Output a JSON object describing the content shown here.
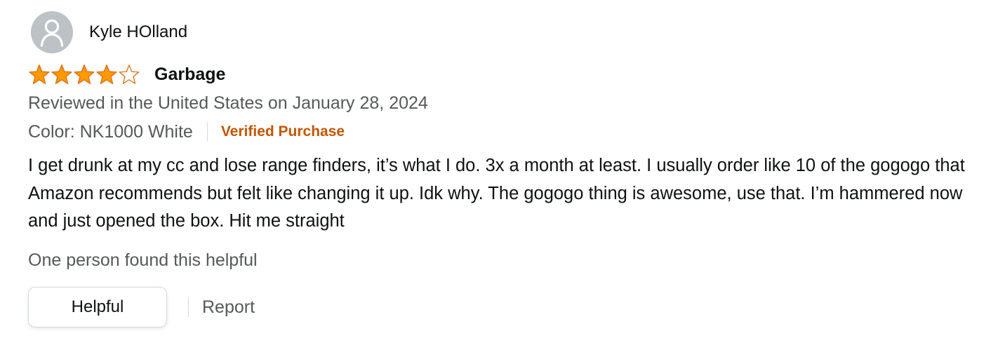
{
  "review": {
    "profile": {
      "name": "Kyle HOlland",
      "avatar_icon": "default-user-avatar-icon"
    },
    "rating": {
      "value": 4,
      "out_of": 5,
      "star_color": "#ff9900",
      "star_outline_color": "#de7921"
    },
    "title": "Garbage",
    "date_line": "Reviewed in the United States on January 28, 2024",
    "variant": "Color: NK1000 White",
    "verified": "Verified Purchase",
    "body": "I get drunk at my cc and lose range finders, it’s what I do. 3x a month at least. I usually order like 10 of the gogogo that Amazon recommends but felt like changing it up. Idk why. The gogogo thing is awesome, use that. I’m hammered now and just opened the box. Hit me straight",
    "helpful_text": "One person found this helpful",
    "actions": {
      "helpful_label": "Helpful",
      "report_label": "Report"
    }
  }
}
